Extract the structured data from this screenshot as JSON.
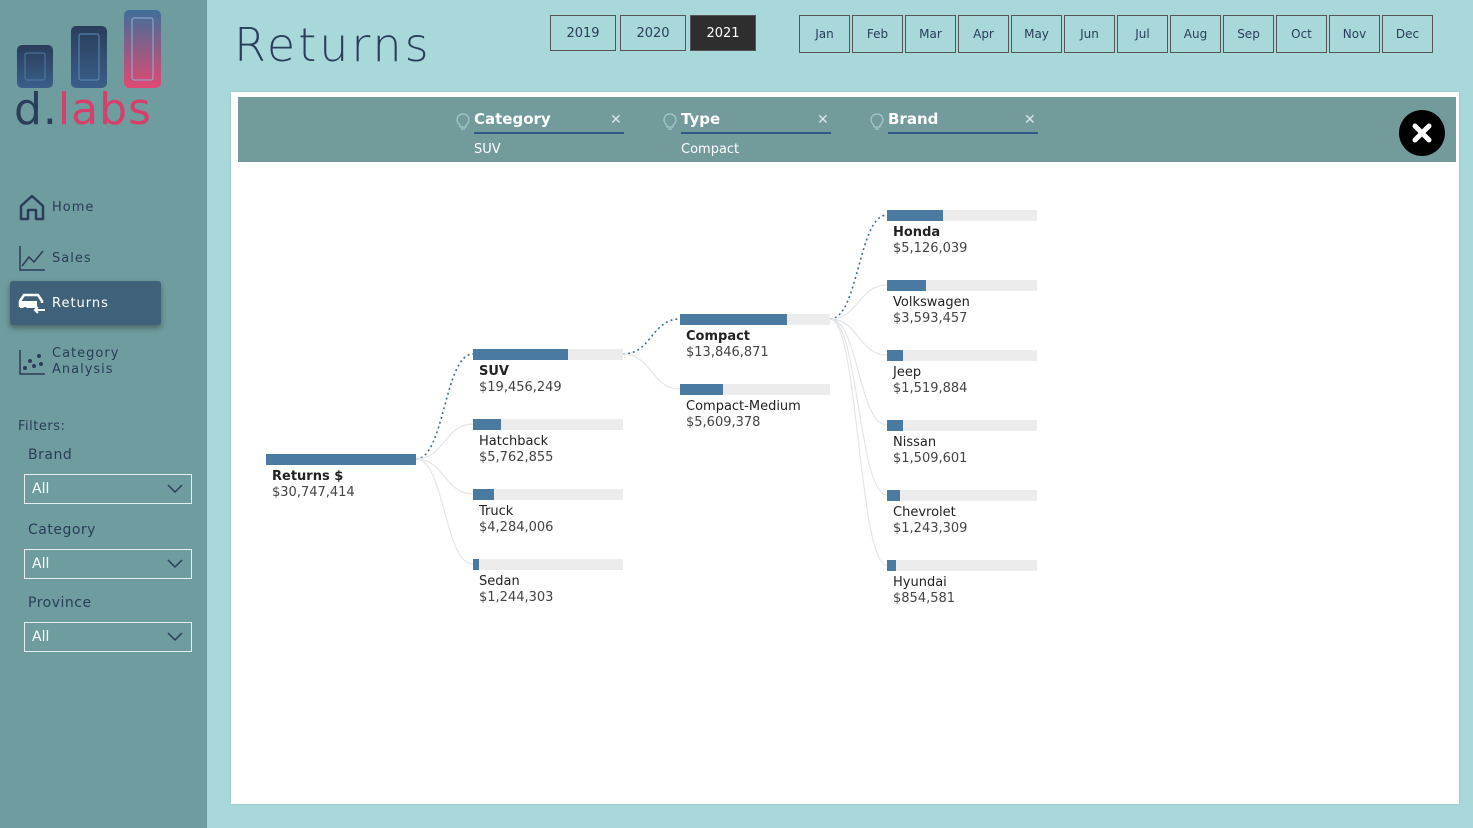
{
  "app": {
    "logo_text_a": "d.",
    "logo_text_b": "labs",
    "page_title": "Returns"
  },
  "colors": {
    "sidebar_bg": "#6f9c9e",
    "page_bg": "#a8d8da",
    "navy": "#2a3d5a",
    "accent_pink": "#d63f69",
    "bar_fill": "#4a7aa0",
    "bar_track": "#ececec",
    "active_nav": "#3f6179"
  },
  "nav": [
    {
      "label": "Home",
      "icon": "home-icon"
    },
    {
      "label": "Sales",
      "icon": "line-chart-icon"
    },
    {
      "label": "Returns",
      "icon": "car-return-icon",
      "active": true
    },
    {
      "label1": "Category",
      "label2": "Analysis",
      "icon": "scatter-chart-icon"
    }
  ],
  "filters": {
    "heading": "Filters:",
    "brand": {
      "label": "Brand",
      "value": "All"
    },
    "category": {
      "label": "Category",
      "value": "All"
    },
    "province": {
      "label": "Province",
      "value": "All"
    }
  },
  "years": [
    {
      "label": "2019",
      "selected": false
    },
    {
      "label": "2020",
      "selected": false
    },
    {
      "label": "2021",
      "selected": true
    }
  ],
  "months": [
    "Jan",
    "Feb",
    "Mar",
    "Apr",
    "May",
    "Jun",
    "Jul",
    "Aug",
    "Sep",
    "Oct",
    "Nov",
    "Dec"
  ],
  "levels": [
    {
      "title": "Category",
      "selection": "SUV"
    },
    {
      "title": "Type",
      "selection": "Compact"
    },
    {
      "title": "Brand",
      "selection": ""
    }
  ],
  "tree": {
    "root": {
      "name": "Returns $",
      "value_label": "$30,747,414",
      "value": 30747414
    },
    "category": [
      {
        "name": "SUV",
        "value_label": "$19,456,249",
        "value": 19456249,
        "selected": true
      },
      {
        "name": "Hatchback",
        "value_label": "$5,762,855",
        "value": 5762855
      },
      {
        "name": "Truck",
        "value_label": "$4,284,006",
        "value": 4284006
      },
      {
        "name": "Sedan",
        "value_label": "$1,244,303",
        "value": 1244303
      }
    ],
    "type": [
      {
        "name": "Compact",
        "value_label": "$13,846,871",
        "value": 13846871,
        "selected": true
      },
      {
        "name": "Compact-Medium",
        "value_label": "$5,609,378",
        "value": 5609378
      }
    ],
    "brand": [
      {
        "name": "Honda",
        "value_label": "$5,126,039",
        "value": 5126039,
        "selected": true
      },
      {
        "name": "Volkswagen",
        "value_label": "$3,593,457",
        "value": 3593457
      },
      {
        "name": "Jeep",
        "value_label": "$1,519,884",
        "value": 1519884
      },
      {
        "name": "Nissan",
        "value_label": "$1,509,601",
        "value": 1509601
      },
      {
        "name": "Chevrolet",
        "value_label": "$1,243,309",
        "value": 1243309
      },
      {
        "name": "Hyundai",
        "value_label": "$854,581",
        "value": 854581
      }
    ]
  }
}
